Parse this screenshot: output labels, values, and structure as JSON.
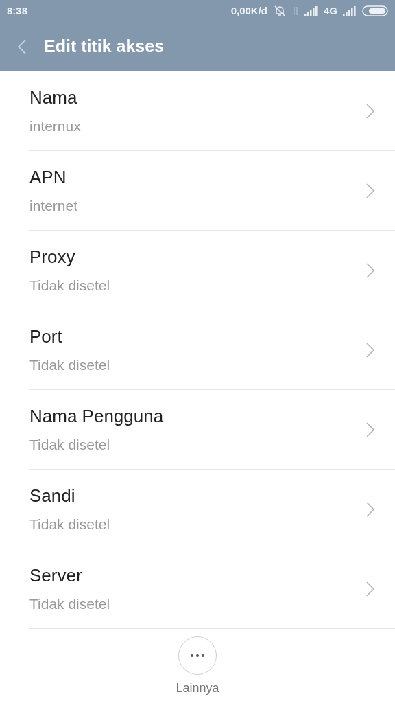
{
  "status_bar": {
    "time": "8:38",
    "speed": "0,00K/d",
    "network": "4G"
  },
  "header": {
    "title": "Edit titik akses"
  },
  "items": [
    {
      "label": "Nama",
      "value": "internux"
    },
    {
      "label": "APN",
      "value": "internet"
    },
    {
      "label": "Proxy",
      "value": "Tidak disetel"
    },
    {
      "label": "Port",
      "value": "Tidak disetel"
    },
    {
      "label": "Nama Pengguna",
      "value": "Tidak disetel"
    },
    {
      "label": "Sandi",
      "value": "Tidak disetel"
    },
    {
      "label": "Server",
      "value": "Tidak disetel"
    }
  ],
  "bottom_bar": {
    "more_label": "Lainnya"
  }
}
